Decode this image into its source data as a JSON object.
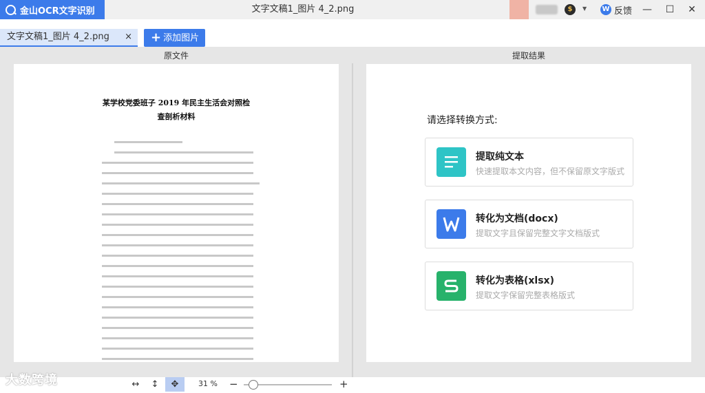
{
  "app": {
    "name": "金山OCR文字识别",
    "document_title": "文字文稿1_图片 4_2.png"
  },
  "titlebar": {
    "feedback_label": "反馈",
    "coin_glyph": "$",
    "feedback_glyph": "W"
  },
  "tabs": {
    "file_tab_label": "文字文稿1_图片 4_2.png",
    "close_glyph": "×",
    "add_image_label": "添加图片"
  },
  "panes": {
    "original_label": "原文件",
    "result_label": "提取结果"
  },
  "document": {
    "title_line1": "某学校党委班子 2019 年民主生活会对照检",
    "title_line2": "查剖析材料"
  },
  "result": {
    "prompt": "请选择转换方式:",
    "options": [
      {
        "title": "提取纯文本",
        "description": "快速提取本文内容，但不保留原文字版式",
        "icon": "text-lines-icon",
        "color": "#2ec4c6"
      },
      {
        "title": "转化为文档(docx)",
        "description": "提取文字且保留完整文字文档版式",
        "icon": "word-doc-icon",
        "color": "#3c7bea"
      },
      {
        "title": "转化为表格(xlsx)",
        "description": "提取文字保留完整表格版式",
        "icon": "spreadsheet-icon",
        "color": "#27b26b"
      }
    ]
  },
  "bottombar": {
    "zoom_text": "31 %",
    "zoom_percent": 31,
    "watermark": "大数跨境"
  },
  "colors": {
    "accent": "#3c7bea",
    "workspace": "#e6e6e6"
  }
}
